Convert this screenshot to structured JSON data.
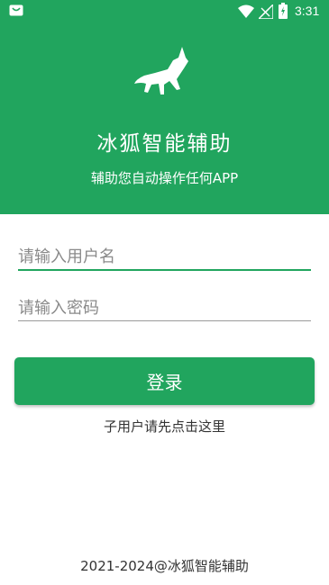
{
  "status_bar": {
    "time": "3:31",
    "icons": [
      "notification-icon",
      "wifi-icon",
      "signal-icon",
      "battery-icon"
    ]
  },
  "header": {
    "logo": "fox-logo",
    "title": "冰狐智能辅助",
    "subtitle": "辅助您自动操作任何APP",
    "background_color": "#21a55e"
  },
  "form": {
    "username_placeholder": "请输入用户名",
    "username_value": "",
    "password_placeholder": "请输入密码",
    "password_value": "",
    "login_label": "登录",
    "sub_user_link": "子用户请先点击这里"
  },
  "footer": {
    "copyright": "2021-2024@冰狐智能辅助"
  },
  "colors": {
    "accent": "#21a55e"
  }
}
